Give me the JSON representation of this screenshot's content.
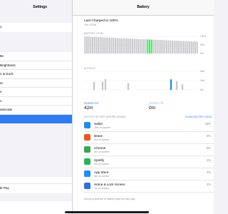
{
  "sidebar": {
    "title": "Settings",
    "groups": [
      [
        "o"
      ],
      [
        "tte",
        "Brightness",
        "n & Dock",
        "er",
        "n",
        "n",
        "asscode",
        ""
      ],
      [
        "le Pay"
      ],
      [
        ""
      ]
    ]
  },
  "header": {
    "title": "Battery"
  },
  "charge": {
    "title": "Last Charged to 100%",
    "date": "Tue 20:09"
  },
  "level_label": "BATTERY LEVEL",
  "level_ticks": [
    "100%",
    "50%",
    "0%"
  ],
  "activity_label": "ACTIVITY",
  "activity_ticks": [
    "60m",
    "30m",
    "0m"
  ],
  "screen_on": {
    "label": "Screen On",
    "value": "42m"
  },
  "screen_off": {
    "label": "Screen Off",
    "value": "0m"
  },
  "apps_label": "ACTIVITY BY APP (HOURS INSIDE)",
  "apps_link": "SHOW BATTERY USAG",
  "apps": [
    {
      "name": "Safari",
      "sub": "28m on screen",
      "pct": "29%",
      "color": "#1d8cf8",
      "icon": "safari-icon"
    },
    {
      "name": "Brave",
      "sub": "9m on screen",
      "pct": "5%",
      "color": "#f5521f",
      "icon": "brave-icon"
    },
    {
      "name": "Chrome",
      "sub": "5m on screen",
      "pct": "5%",
      "color": "#34a853",
      "icon": "chrome-icon"
    },
    {
      "name": "Spotify",
      "sub": "5m on screen",
      "pct": "3%",
      "color": "#1db954",
      "icon": "spotify-icon"
    },
    {
      "name": "App Store",
      "sub": "5m on screen",
      "pct": "3%",
      "color": "#1a8cff",
      "icon": "app-store-icon"
    },
    {
      "name": "Home & Lock Screen",
      "sub": "1m on screen",
      "pct": "2%",
      "color": "#2f6fe4",
      "icon": "home-lock-icon"
    }
  ],
  "footer": "Shows proportion of battery used by each app.",
  "chart_data": [
    {
      "type": "bar",
      "title": "",
      "xlabel": "",
      "ylabel": "BATTERY LEVEL",
      "ylim": [
        0,
        100
      ],
      "values": [
        99,
        99,
        98,
        98,
        97,
        97,
        96,
        96,
        95,
        95,
        94,
        94,
        93,
        93,
        92,
        92,
        91,
        91,
        90,
        90,
        89,
        89,
        88,
        88,
        88,
        87,
        86,
        86,
        85,
        84,
        84,
        83,
        83,
        82,
        82,
        81,
        81,
        80,
        80,
        79,
        79,
        78,
        78,
        77,
        77,
        76,
        76,
        75,
        75,
        74,
        74,
        73,
        73,
        72,
        72,
        71,
        71,
        70,
        70,
        69
      ],
      "highlight": [
        33,
        34,
        35
      ],
      "highlight_color": "#4cd964",
      "color": "#c7c7cc"
    },
    {
      "type": "bar",
      "title": "",
      "xlabel": "",
      "ylabel": "ACTIVITY",
      "ylim": [
        0,
        60
      ],
      "series": [
        {
          "values": [
            0,
            0,
            0,
            26,
            0,
            0,
            26,
            35,
            0,
            0,
            0,
            0,
            0,
            0,
            0,
            22,
            0,
            0,
            0,
            0,
            0,
            0,
            0,
            0,
            0,
            0,
            0,
            0,
            0,
            0,
            0,
            0,
            0,
            0,
            0,
            0,
            0,
            0,
            0,
            0
          ],
          "color": "#c7c7cc"
        },
        {
          "values": [
            0,
            0,
            0,
            0,
            0,
            0,
            0,
            0,
            0,
            0,
            0,
            0,
            0,
            0,
            0,
            0,
            0,
            0,
            0,
            0,
            0,
            0,
            0,
            0,
            0,
            0,
            0,
            0,
            0,
            0,
            34,
            0,
            0,
            0,
            0,
            0,
            0,
            0,
            0,
            0
          ],
          "color": "#1d8cf8"
        },
        {
          "values": [
            0,
            0,
            0,
            0,
            0,
            0,
            0,
            0,
            0,
            0,
            0,
            0,
            0,
            0,
            0,
            0,
            0,
            0,
            0,
            0,
            0,
            0,
            0,
            0,
            0,
            0,
            0,
            0,
            0,
            0,
            0,
            0,
            28,
            0,
            18,
            0,
            0,
            0,
            0,
            0
          ],
          "color": "#c7c7cc"
        }
      ]
    }
  ]
}
